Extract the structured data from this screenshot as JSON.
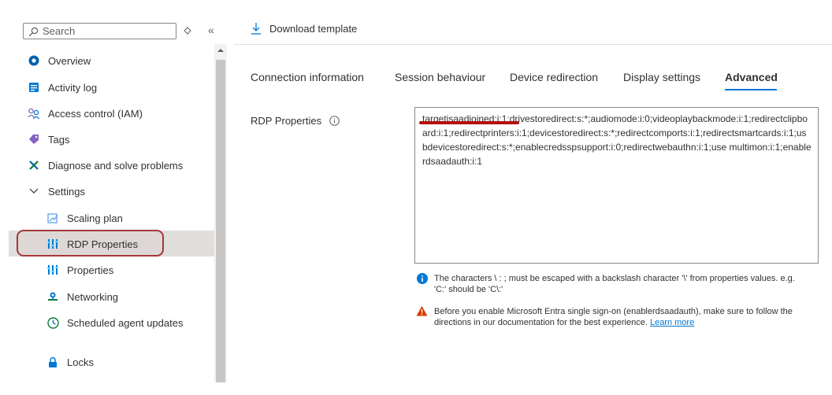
{
  "sidebar": {
    "search": {
      "placeholder": "Search",
      "value": ""
    },
    "items": [
      {
        "label": "Overview",
        "icon": "overview-icon"
      },
      {
        "label": "Activity log",
        "icon": "activity-log-icon"
      },
      {
        "label": "Access control (IAM)",
        "icon": "access-control-icon"
      },
      {
        "label": "Tags",
        "icon": "tag-icon"
      },
      {
        "label": "Diagnose and solve problems",
        "icon": "wrench-icon"
      },
      {
        "label": "Settings",
        "icon": "chevron-down-icon"
      },
      {
        "label": "Scaling plan",
        "icon": "scaling-plan-icon"
      },
      {
        "label": "RDP Properties",
        "icon": "properties-icon"
      },
      {
        "label": "Properties",
        "icon": "properties-icon"
      },
      {
        "label": "Networking",
        "icon": "networking-icon"
      },
      {
        "label": "Scheduled agent updates",
        "icon": "clock-icon"
      },
      {
        "label": "Locks",
        "icon": "lock-icon"
      }
    ],
    "selected": "RDP Properties"
  },
  "toolbar": {
    "download_label": "Download template",
    "download_icon": "download-icon"
  },
  "tabs": [
    {
      "label": "Connection information",
      "active": false
    },
    {
      "label": "Session behaviour",
      "active": false
    },
    {
      "label": "Device redirection",
      "active": false
    },
    {
      "label": "Display settings",
      "active": false
    },
    {
      "label": "Advanced",
      "active": true
    }
  ],
  "rdp": {
    "label": "RDP Properties",
    "value": "targetisaadjoined:i:1;drivestoredirect:s:*;audiomode:i:0;videoplaybackmode:i:1;redirectclipboard:i:1;redirectprinters:i:1;devicestoredirect:s:*;redirectcomports:i:1;redirectsmartcards:i:1;usbdevicestoredirect:s:*;enablecredsspsupport:i:0;redirectwebauthn:i:1;use multimon:i:1;enablerdsaadauth:i:1"
  },
  "notes": {
    "info_text": "The characters \\ : ; must be escaped with a backslash character '\\' from properties values. e.g. 'C:' should be 'C\\:'",
    "warning_text": "Before you enable Microsoft Entra single sign-on (enablerdsaadauth), make sure to follow the directions in our documentation for the best experience.",
    "learn_more": "Learn more"
  },
  "colors": {
    "accent": "#0078d4",
    "highlight_border": "#a4373a",
    "annotation_underline": "#b30f0f",
    "warning": "#d83b01"
  }
}
